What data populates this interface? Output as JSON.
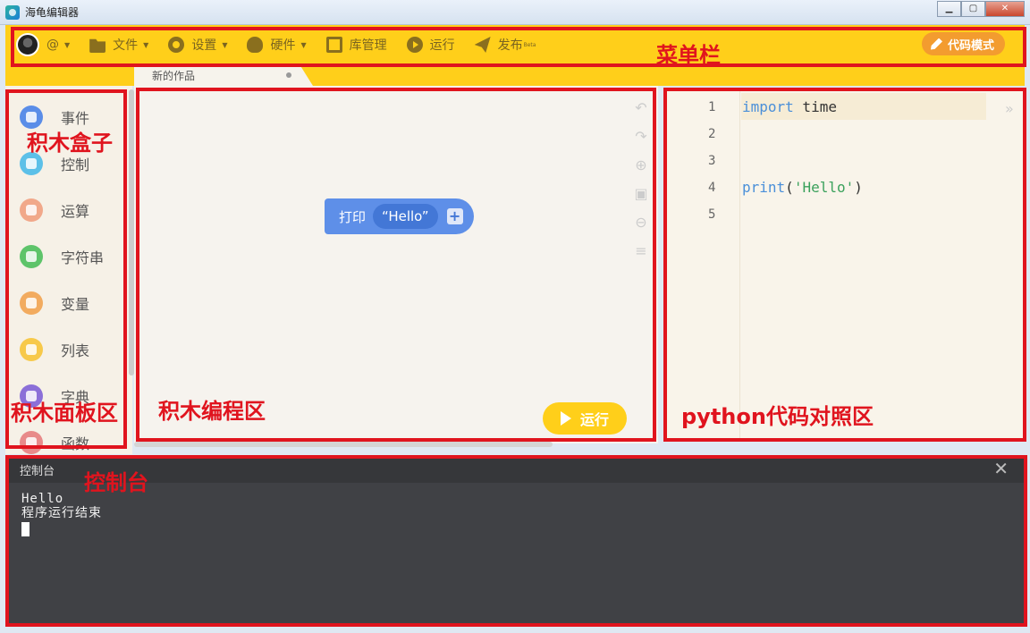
{
  "window": {
    "title": "海龟编辑器",
    "min": "▁",
    "max": "▢",
    "close": "✕"
  },
  "menubar": {
    "items": [
      {
        "icon": "at-icon",
        "label": "@"
      },
      {
        "icon": "folder-icon",
        "label": "文件"
      },
      {
        "icon": "gear-icon",
        "label": "设置"
      },
      {
        "icon": "hardware-icon",
        "label": "硬件"
      },
      {
        "icon": "library-icon",
        "label": "库管理"
      },
      {
        "icon": "run-icon",
        "label": "运行"
      },
      {
        "icon": "publish-icon",
        "label": "发布",
        "badge": "Beta"
      }
    ],
    "code_mode": "代码模式"
  },
  "tab": {
    "label": "新的作品"
  },
  "categories": [
    {
      "label": "事件",
      "color": "#5a8de8"
    },
    {
      "label": "控制",
      "color": "#5cc0e8"
    },
    {
      "label": "运算",
      "color": "#f1a88a"
    },
    {
      "label": "字符串",
      "color": "#5ec46a"
    },
    {
      "label": "变量",
      "color": "#f2ab5f"
    },
    {
      "label": "列表",
      "color": "#f7c94a"
    },
    {
      "label": "字典",
      "color": "#8b6fd8"
    },
    {
      "label": "函数",
      "color": "#e88a8a"
    }
  ],
  "workspace": {
    "block": {
      "label": "打印",
      "value": "“Hello”",
      "plus": "+"
    },
    "run_label": "运行"
  },
  "code": {
    "lines": [
      "1",
      "2",
      "3",
      "4",
      "5"
    ],
    "line1": {
      "kw": "import",
      "rest": " time"
    },
    "line4": {
      "fn": "print",
      "open": "(",
      "str": "'Hello'",
      "close": ")"
    }
  },
  "console": {
    "title": "控制台",
    "output": [
      "Hello",
      "程序运行结束"
    ]
  },
  "annotations": {
    "menubar": "菜单栏",
    "blockbox": "积木盒子",
    "blockpanel": "积木面板区",
    "blockarea": "积木编程区",
    "codearea": "python代码对照区",
    "console": "控制台",
    "color": "#e0141e"
  }
}
